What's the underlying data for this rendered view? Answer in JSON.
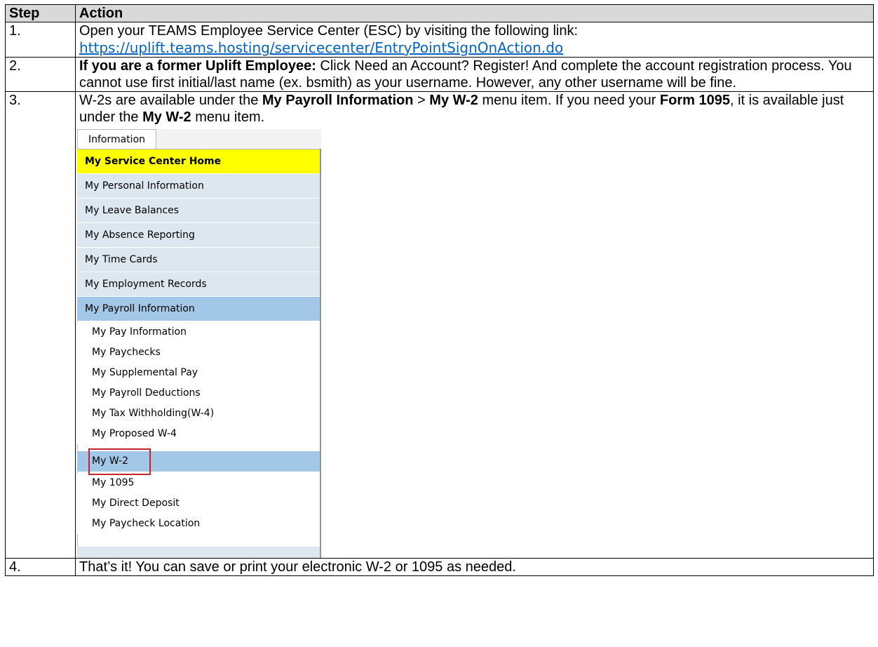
{
  "table": {
    "header": {
      "step": "Step",
      "action": "Action"
    },
    "rows": [
      {
        "step": "1.",
        "text": "Open your TEAMS Employee Service Center (ESC) by visiting the following link:",
        "link": "https://uplift.teams.hosting/servicecenter/EntryPointSignOnAction.do"
      },
      {
        "step": "2.",
        "bold": "If you are a former Uplift Employee:",
        "text": " Click Need an Account? Register! And complete the account registration process. You cannot use first initial/last name (ex. bsmith) as your username. However, any other username will be fine."
      },
      {
        "step": "3.",
        "t1": "W-2s are available under the ",
        "b1": "My Payroll Information",
        "t2": " > ",
        "b2": "My W-2",
        "t3": " menu item. If you need your ",
        "b3": "Form 1095",
        "t4": ", it is available just under the ",
        "b4": "My W-2",
        "t5": " menu item."
      },
      {
        "step": "4.",
        "text": "That’s it! You can save or print your electronic W-2 or 1095 as needed."
      }
    ]
  },
  "menu": {
    "tab": "Information",
    "top_items": [
      "My Service Center Home",
      "My Personal Information",
      "My Leave Balances",
      "My Absence Reporting",
      "My Time Cards",
      "My Employment Records",
      "My Payroll Information"
    ],
    "sub_items": [
      "My Pay Information",
      "My Paychecks",
      "My Supplemental Pay",
      "My Payroll Deductions",
      "My Tax Withholding(W-4)",
      "My Proposed W-4",
      "My W-2",
      "My 1095",
      "My Direct Deposit",
      "My Paycheck Location"
    ],
    "colors": {
      "home_bg": "#ffff00",
      "selected_bg": "#a3c7e6",
      "item_bg": "#dde7ef",
      "highlight_border": "#c0262c"
    }
  }
}
